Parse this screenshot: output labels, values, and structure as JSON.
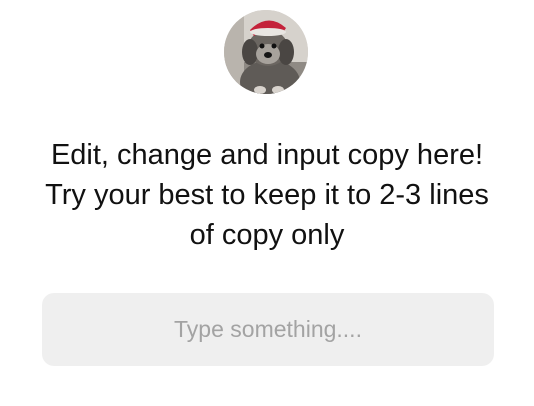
{
  "message": {
    "avatar_icon": "dog-avatar",
    "copy_text": "Edit, change and input copy here! Try your best to keep it to 2-3 lines of copy only"
  },
  "input": {
    "value": "",
    "placeholder": "Type something...."
  }
}
